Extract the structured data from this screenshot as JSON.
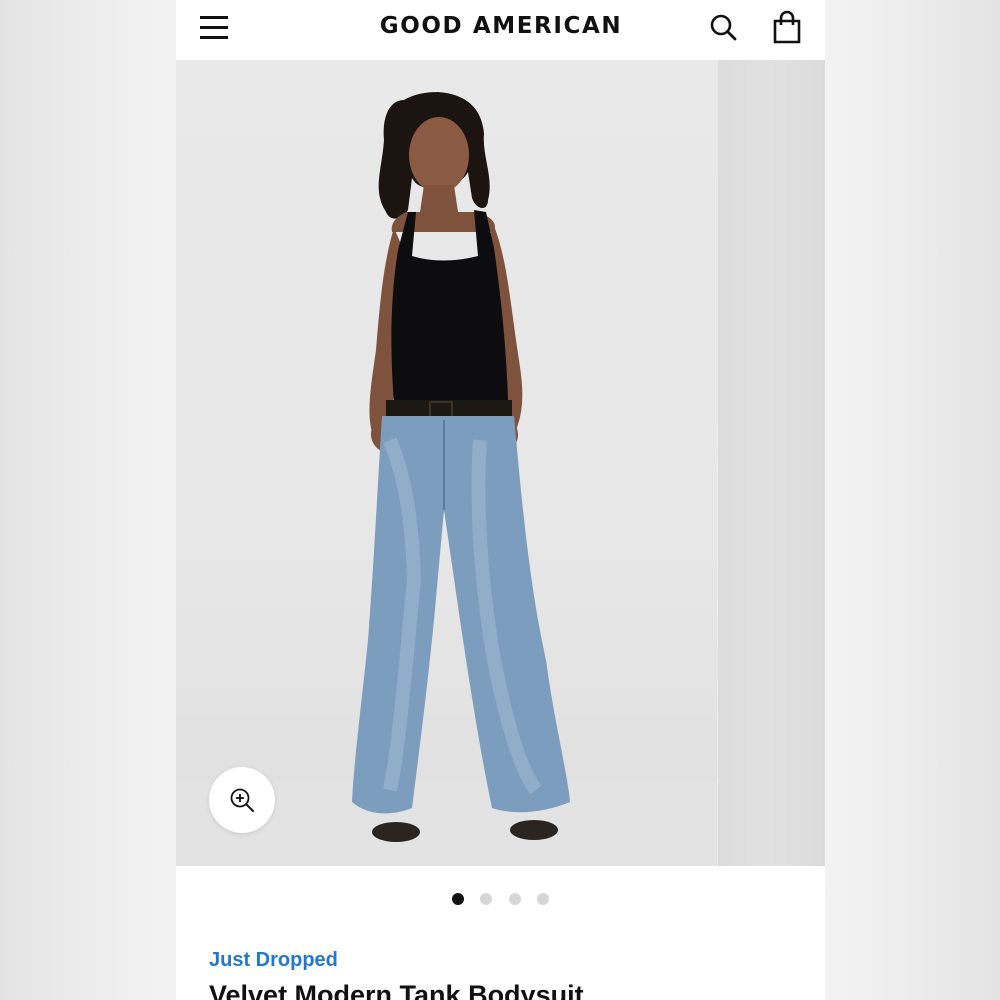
{
  "header": {
    "brand": "GOOD AMERICAN",
    "menu_icon": "hamburger-menu-icon",
    "search_icon": "search-icon",
    "bag_icon": "shopping-bag-icon"
  },
  "gallery": {
    "slide_count": 4,
    "active_index": 0,
    "zoom_icon": "zoom-in-icon",
    "photo_description": "model-photo"
  },
  "product": {
    "tag": "Just Dropped",
    "title": "Velvet Modern Tank Bodysuit"
  },
  "colors": {
    "tag": "#2479c6",
    "text": "#111111",
    "dot_active": "#111111",
    "dot_inactive": "#d6d6d6"
  }
}
